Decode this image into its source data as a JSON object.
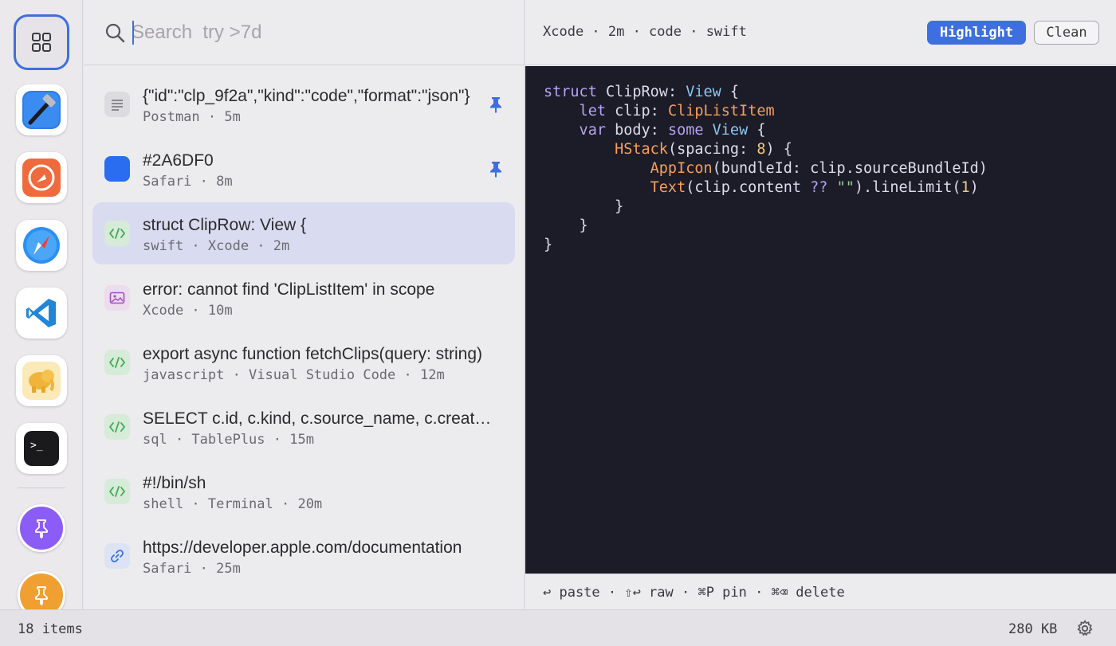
{
  "search": {
    "placeholder": "Search  try >7d",
    "value": ""
  },
  "sidebar": {
    "items": [
      {
        "name": "all-clips",
        "icon": "grid-icon"
      },
      {
        "name": "xcode",
        "icon": "hammer-icon"
      },
      {
        "name": "postman",
        "icon": "postman-icon"
      },
      {
        "name": "safari",
        "icon": "compass-icon"
      },
      {
        "name": "vscode",
        "icon": "vscode-icon"
      },
      {
        "name": "tableplus",
        "icon": "elephant-icon"
      },
      {
        "name": "terminal",
        "icon": "terminal-icon"
      }
    ],
    "terminal_glyph": ">_",
    "pins": [
      {
        "name": "pinned-purple",
        "color": "#8b5cf6"
      },
      {
        "name": "pinned-orange",
        "color": "#f0a030"
      }
    ]
  },
  "clips": [
    {
      "title": "{\"id\":\"clp_9f2a\",\"kind\":\"code\",\"format\":\"json\"}",
      "meta": "Postman · 5m",
      "kind": "text",
      "pinned": true,
      "selected": false
    },
    {
      "title": "#2A6DF0",
      "meta": "Safari · 8m",
      "kind": "color",
      "color": "#2A6DF0",
      "pinned": true,
      "selected": false
    },
    {
      "title": "struct ClipRow: View {",
      "meta": "swift · Xcode · 2m",
      "kind": "code",
      "pinned": false,
      "selected": true
    },
    {
      "title": "error: cannot find 'ClipListItem' in scope",
      "meta": "Xcode · 10m",
      "kind": "image",
      "pinned": false,
      "selected": false
    },
    {
      "title": "export async function fetchClips(query: string)",
      "meta": "javascript · Visual Studio Code · 12m",
      "kind": "code",
      "pinned": false,
      "selected": false
    },
    {
      "title": "SELECT c.id, c.kind, c.source_name, c.created_at",
      "meta": "sql · TablePlus · 15m",
      "kind": "code",
      "pinned": false,
      "selected": false
    },
    {
      "title": "#!/bin/sh",
      "meta": "shell · Terminal · 20m",
      "kind": "code",
      "pinned": false,
      "selected": false
    },
    {
      "title": "https://developer.apple.com/documentation",
      "meta": "Safari · 25m",
      "kind": "link",
      "pinned": false,
      "selected": false
    }
  ],
  "detail": {
    "meta": "Xcode · 2m · code · swift",
    "highlight_label": "Highlight",
    "clean_label": "Clean",
    "code_lines": [
      [
        [
          "struct ",
          "kw"
        ],
        [
          "ClipRow",
          "plain"
        ],
        [
          ": ",
          "plain"
        ],
        [
          "View",
          "ty"
        ],
        [
          " {",
          "plain"
        ]
      ],
      [
        [
          "    let ",
          "kw"
        ],
        [
          "clip",
          "plain"
        ],
        [
          ": ",
          "plain"
        ],
        [
          "ClipListItem",
          "fn"
        ]
      ],
      [
        [
          "    var ",
          "kw"
        ],
        [
          "body",
          "plain"
        ],
        [
          ": ",
          "plain"
        ],
        [
          "some ",
          "kw"
        ],
        [
          "View",
          "ty"
        ],
        [
          " {",
          "plain"
        ]
      ],
      [
        [
          "        ",
          "plain"
        ],
        [
          "HStack",
          "fn"
        ],
        [
          "(spacing: ",
          "plain"
        ],
        [
          "8",
          "num"
        ],
        [
          ") {",
          "plain"
        ]
      ],
      [
        [
          "            ",
          "plain"
        ],
        [
          "AppIcon",
          "fn"
        ],
        [
          "(bundleId: clip.sourceBundleId)",
          "plain"
        ]
      ],
      [
        [
          "            ",
          "plain"
        ],
        [
          "Text",
          "fn"
        ],
        [
          "(clip.content ",
          "plain"
        ],
        [
          "??",
          "kw"
        ],
        [
          " ",
          "plain"
        ],
        [
          "\"\"",
          "str"
        ],
        [
          ").lineLimit(",
          "plain"
        ],
        [
          "1",
          "num"
        ],
        [
          ")",
          "plain"
        ]
      ],
      [
        [
          "        }",
          "plain"
        ]
      ],
      [
        [
          "    }",
          "plain"
        ]
      ],
      [
        [
          "}",
          "plain"
        ]
      ]
    ]
  },
  "shortcuts": "↩ paste · ⇧↩ raw · ⌘P pin · ⌘⌫ delete",
  "status": {
    "count": "18 items",
    "size": "280 KB"
  },
  "colors": {
    "accent": "#3d6fe0",
    "code_bg": "#1c1b28",
    "selected_row": "#d9dcf0"
  }
}
